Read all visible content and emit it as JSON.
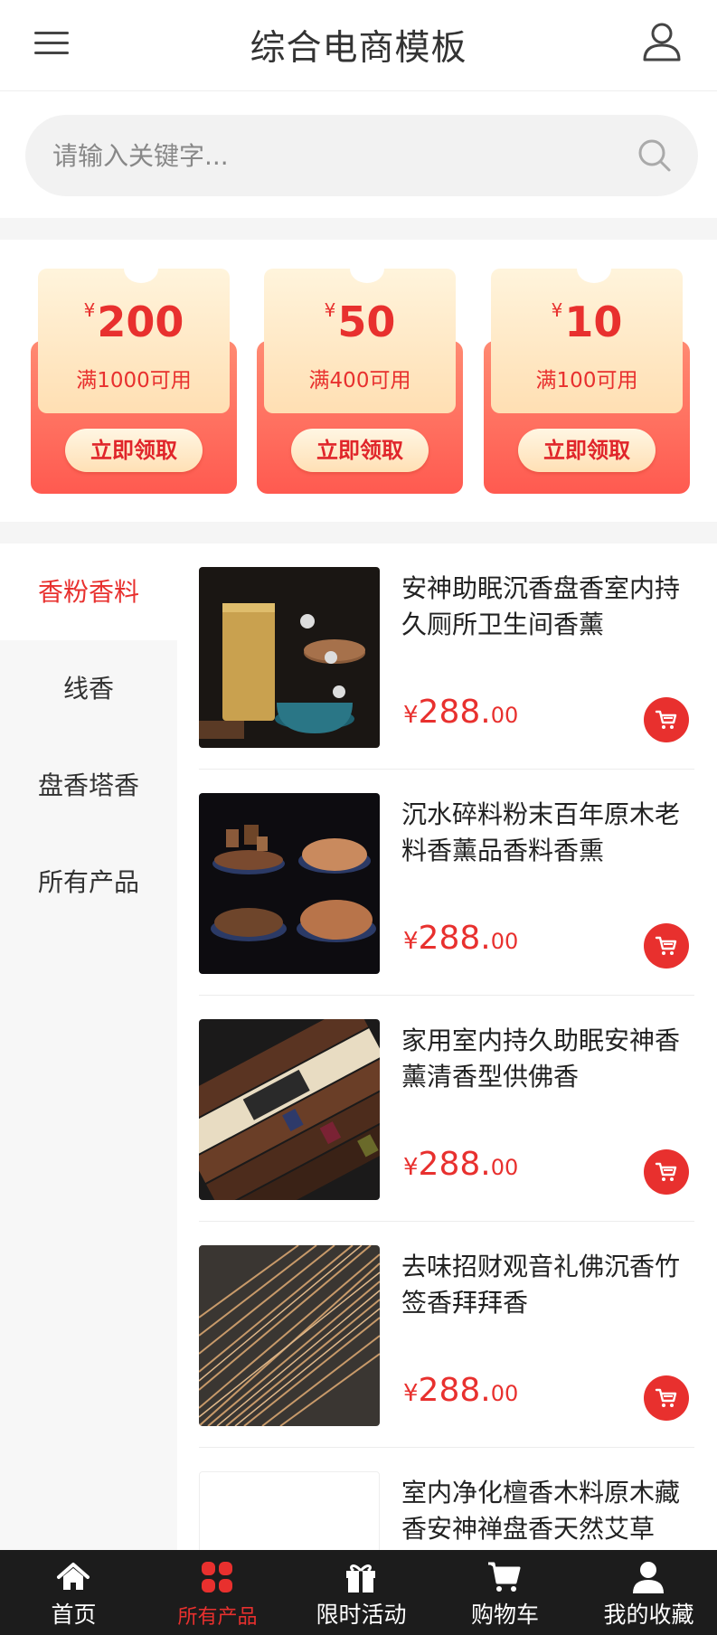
{
  "header": {
    "title": "综合电商模板",
    "menu_icon": "hamburger-menu-icon",
    "user_icon": "user-icon"
  },
  "search": {
    "placeholder": "请输入关键字...",
    "icon": "search-icon"
  },
  "coupons": [
    {
      "currency": "¥",
      "amount": "200",
      "condition": "满1000可用",
      "button": "立即领取"
    },
    {
      "currency": "¥",
      "amount": "50",
      "condition": "满400可用",
      "button": "立即领取"
    },
    {
      "currency": "¥",
      "amount": "10",
      "condition": "满100可用",
      "button": "立即领取"
    }
  ],
  "categories": [
    {
      "label": "香粉香料",
      "active": true
    },
    {
      "label": "线香",
      "active": false
    },
    {
      "label": "盘香塔香",
      "active": false
    },
    {
      "label": "所有产品",
      "active": false
    }
  ],
  "products": [
    {
      "name": "安神助眠沉香盘香室内持久厕所卫生间香薰",
      "currency": "¥",
      "price_int": "288.",
      "price_dec": "00"
    },
    {
      "name": "沉水碎料粉末百年原木老料香薰品香料香熏",
      "currency": "¥",
      "price_int": "288.",
      "price_dec": "00"
    },
    {
      "name": "家用室内持久助眠安神香薰清香型供佛香",
      "currency": "¥",
      "price_int": "288.",
      "price_dec": "00"
    },
    {
      "name": "去味招财观音礼佛沉香竹签香拜拜香",
      "currency": "¥",
      "price_int": "288.",
      "price_dec": "00"
    },
    {
      "name": "室内净化檀香木料原木藏香安神禅盘香天然艾草",
      "currency": "¥",
      "price_int": "",
      "price_dec": ""
    }
  ],
  "tabbar": [
    {
      "label": "首页",
      "icon": "home-icon",
      "active": false
    },
    {
      "label": "所有产品",
      "icon": "grid-icon",
      "active": true
    },
    {
      "label": "限时活动",
      "icon": "gift-icon",
      "active": false
    },
    {
      "label": "购物车",
      "icon": "cart-icon",
      "active": false
    },
    {
      "label": "我的收藏",
      "icon": "user-icon",
      "active": false
    }
  ],
  "colors": {
    "accent": "#e8302e",
    "tabbar_bg": "#1c1c1c",
    "sidebar_bg": "#f7f7f7"
  }
}
